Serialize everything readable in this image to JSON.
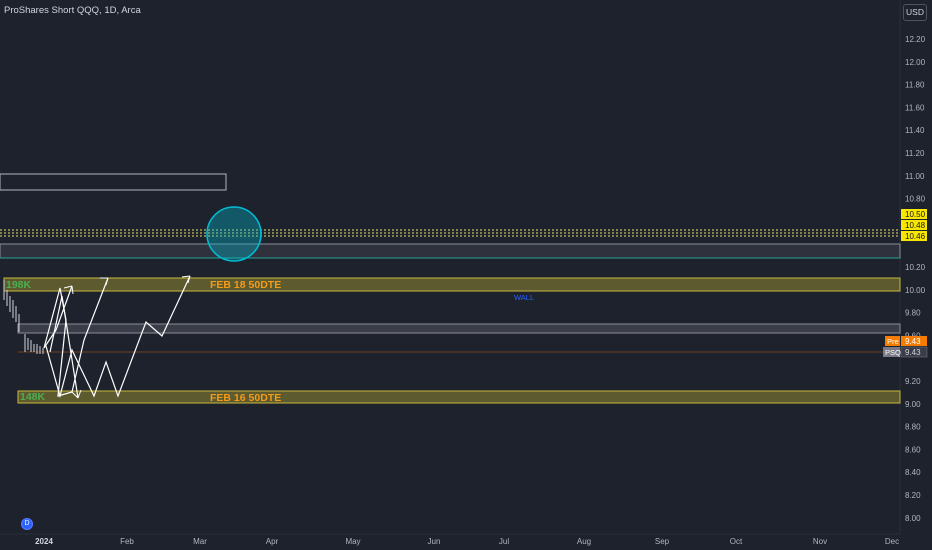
{
  "header": {
    "title": "ProShares Short QQQ, 1D, Arca",
    "currency": "USD"
  },
  "price_axis": {
    "labels": [
      "12.20",
      "12.00",
      "11.80",
      "11.60",
      "11.40",
      "11.20",
      "11.00",
      "10.80",
      "10.20",
      "10.00",
      "9.80",
      "9.60",
      "9.20",
      "9.00",
      "8.80",
      "8.60",
      "8.40",
      "8.20",
      "8.00"
    ],
    "price_tags": [
      {
        "text": "10.50",
        "color": "#f7e600",
        "text_color": "#131722"
      },
      {
        "text": "10.48",
        "color": "#f7e600",
        "text_color": "#131722"
      },
      {
        "text": "10.46",
        "color": "#f7e600",
        "text_color": "#131722"
      }
    ],
    "pre_label": "Pre",
    "pre_value": "9.43",
    "symbol_label": "PSQ",
    "last_value": "9.43"
  },
  "time_axis": {
    "labels": [
      "2024",
      "Feb",
      "Mar",
      "Apr",
      "May",
      "Jun",
      "Jul",
      "Aug",
      "Sep",
      "Oct",
      "Nov",
      "Dec"
    ]
  },
  "annotations": {
    "vol_upper": "198K",
    "vol_lower": "148K",
    "zone_upper_label": "FEB 18 50DTE",
    "zone_lower_label": "FEB 16 50DTE",
    "wall_label": "WALL"
  },
  "logo_text": "D",
  "colors": {
    "background": "#1e222d",
    "zone_fill": "#5c5a2e",
    "zone_border": "#c9b83a",
    "zone_text": "#f59b1a",
    "vol_text": "#4caf50",
    "wall_text": "#2962ff",
    "circle": "#00bcd4",
    "pre_tag": "#f57c00",
    "last_tag": "#787b86"
  },
  "icons": [
    "tradingview-logo-icon"
  ]
}
